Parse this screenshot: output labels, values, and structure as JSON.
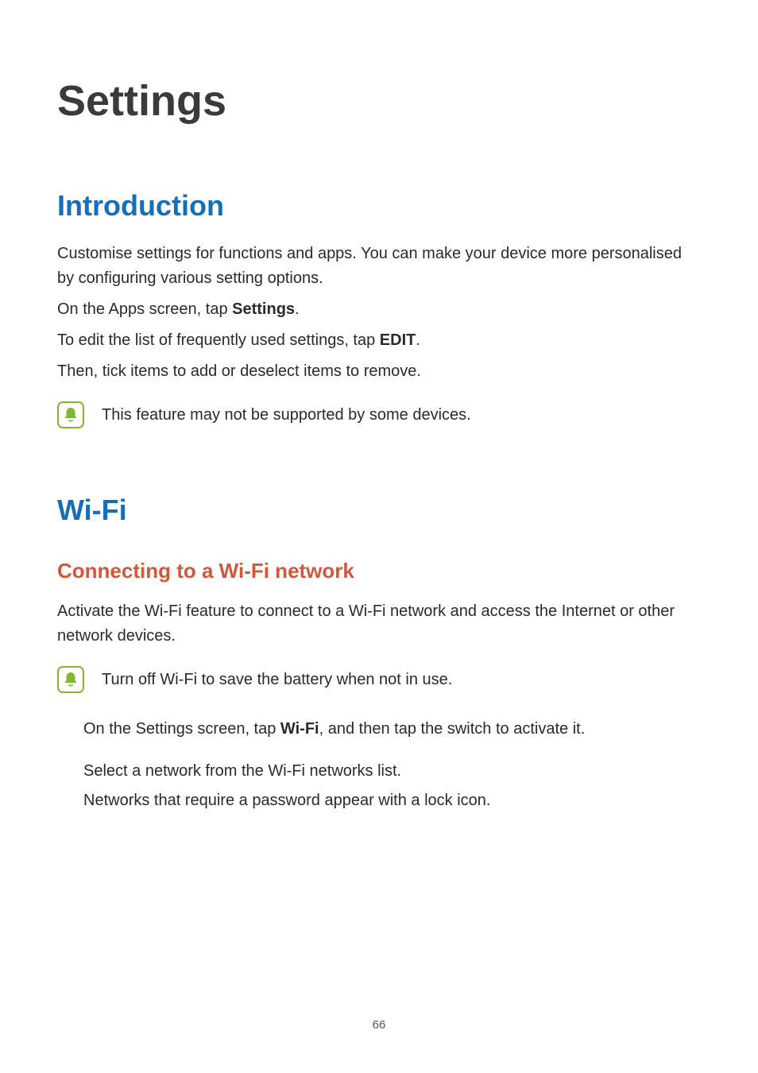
{
  "pageTitle": "Settings",
  "section1": {
    "heading": "Introduction",
    "p1": "Customise settings for functions and apps. You can make your device more personalised by configuring various setting options.",
    "p2_pre": "On the Apps screen, tap ",
    "p2_bold": "Settings",
    "p2_post": ".",
    "p3_pre": "To edit the list of frequently used settings, tap ",
    "p3_bold": "EDIT",
    "p3_post": ".",
    "p4": "Then, tick items to add or deselect items to remove.",
    "note": "This feature may not be supported by some devices."
  },
  "section2": {
    "heading": "Wi-Fi",
    "sub1": {
      "heading": "Connecting to a Wi-Fi network",
      "p1": "Activate the Wi-Fi feature to connect to a Wi-Fi network and access the Internet or other network devices.",
      "note": "Turn off Wi-Fi to save the battery when not in use.",
      "step1_pre": "On the Settings screen, tap ",
      "step1_bold": "Wi-Fi",
      "step1_post": ", and then tap the switch to activate it.",
      "step2a": "Select a network from the Wi-Fi networks list.",
      "step2b": "Networks that require a password appear with a lock icon."
    }
  },
  "pageNumber": "66"
}
